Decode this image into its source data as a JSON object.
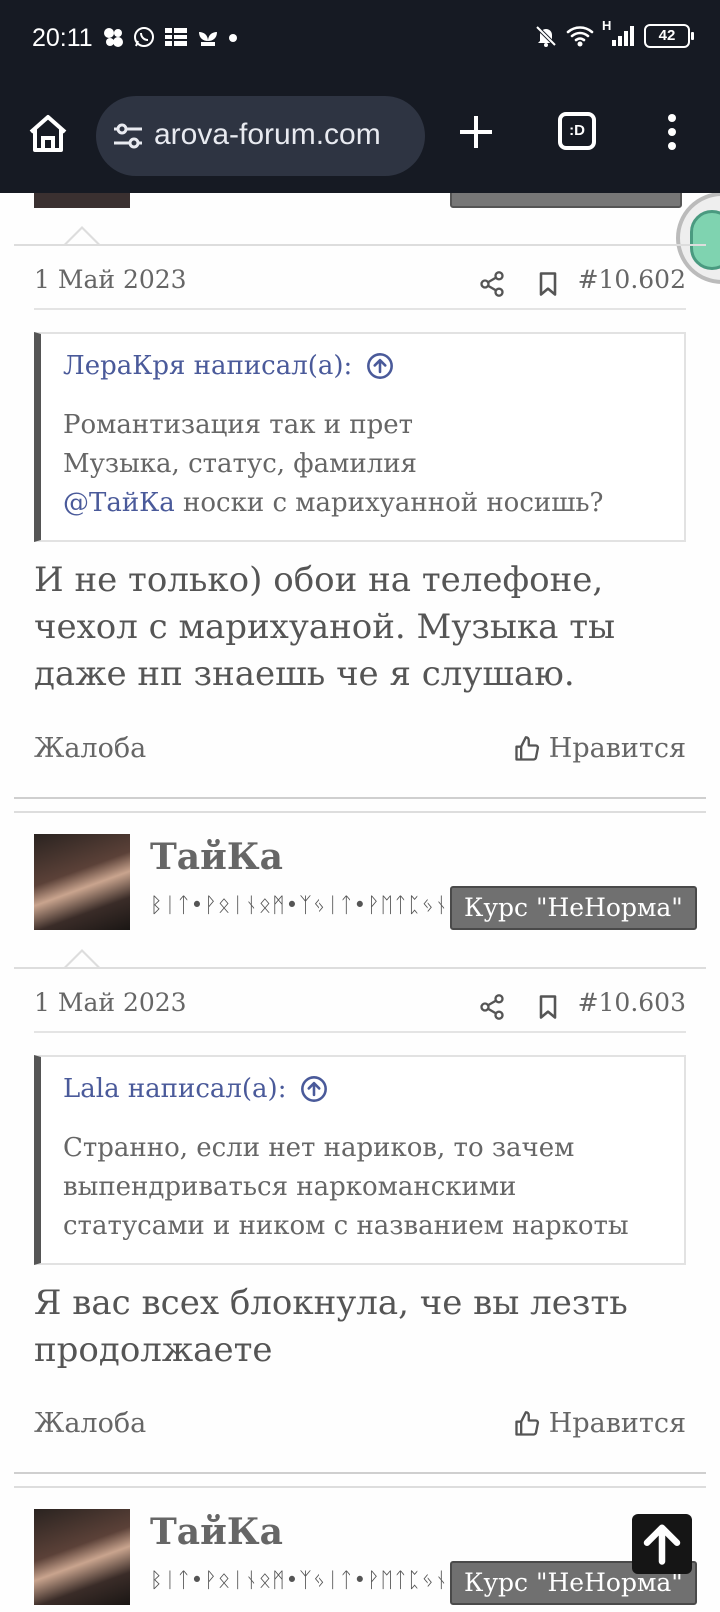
{
  "status_bar": {
    "time": "20:11",
    "network_type": "H",
    "battery": "42"
  },
  "browser": {
    "url": "arova-forum.com",
    "tabs_label": ":D"
  },
  "posts": [
    {
      "date": "1 Май 2023",
      "number": "#10.602",
      "quote_author": "ЛераКря написал(а):",
      "quote_lines": [
        "Романтизация так и прет",
        "Музыка, статус, фамилия"
      ],
      "quote_mention": "@ТайКа",
      "quote_mention_rest": " носки с марихуанной носишь?",
      "text": "И не только) обои на телефоне, чехол с марихуаной. Музыка ты даже нп знаешь че я слушаю.",
      "report": "Жалоба",
      "like": "Нравится"
    },
    {
      "username": "ТайКа",
      "user_title": "ᛒᛁᛏ•ᚹᛟᛁᚾᛟᛗ•ᛉᛃᛁᛏ•ᚹᛖᛏᛈᛃᚾᛟ",
      "badge": "Курс \"НеНорма\"",
      "date": "1 Май 2023",
      "number": "#10.603",
      "quote_author": "Lala написал(а):",
      "quote_lines": [
        "Странно, если нет нариков, то зачем",
        "выпендриваться наркоманскими",
        "статусами и ником с названием наркоты"
      ],
      "text": "Я вас всех блокнула, че вы лезть продолжаете",
      "report": "Жалоба",
      "like": "Нравится"
    },
    {
      "username": "ТайКа",
      "user_title": "ᛒᛁᛏ•ᚹᛟᛁᚾᛟᛗ•ᛉᛃᛁᛏ•ᚹᛖᛏᛈᛃᚾᛟ",
      "badge": "Курс \"НеНорма\""
    }
  ]
}
